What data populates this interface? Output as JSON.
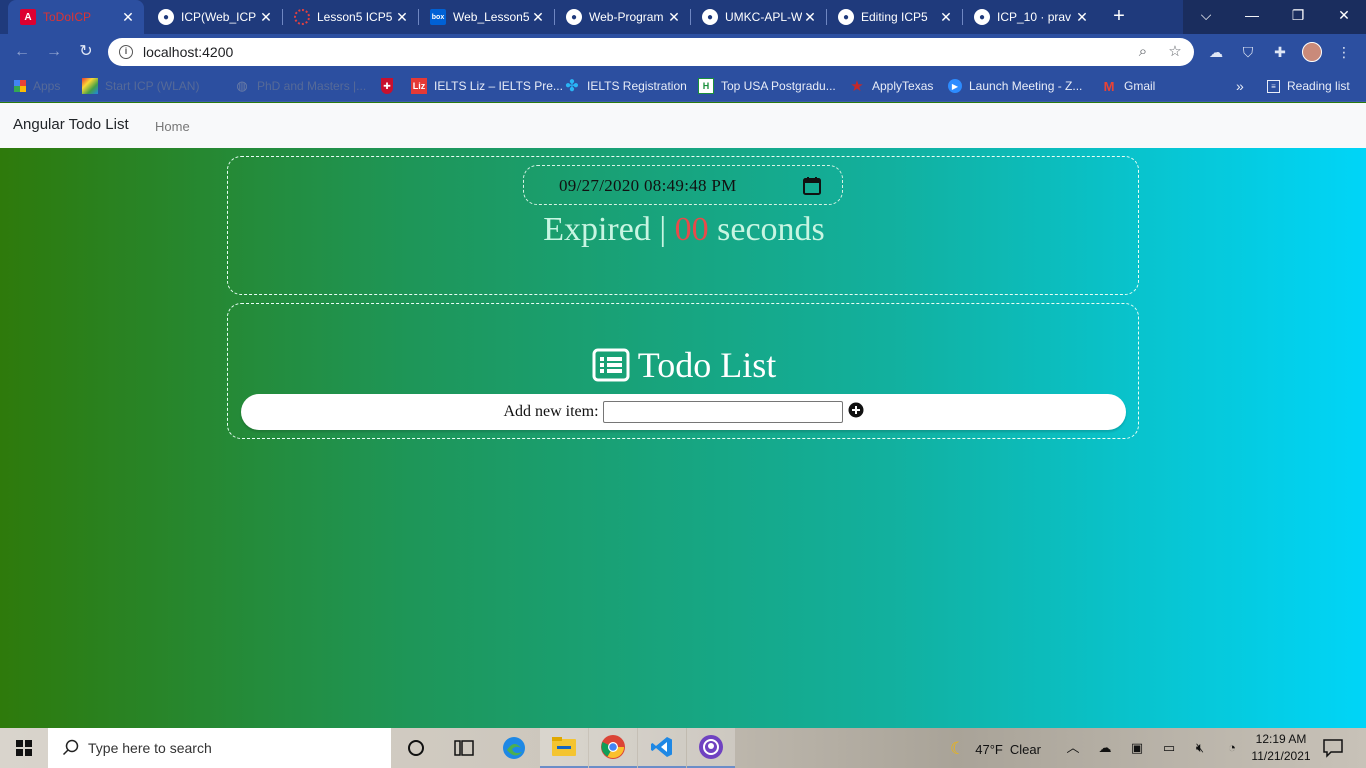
{
  "browser": {
    "tabs": [
      {
        "title": "ToDoICP",
        "favicon": "angular-icon",
        "active": true
      },
      {
        "title": "ICP(Web_ICP",
        "favicon": "github-icon"
      },
      {
        "title": "Lesson5 ICP5",
        "favicon": "loading-icon"
      },
      {
        "title": "Web_Lesson5",
        "favicon": "box-icon"
      },
      {
        "title": "Web-Program",
        "favicon": "github-icon"
      },
      {
        "title": "UMKC-APL-W",
        "favicon": "github-icon"
      },
      {
        "title": "Editing ICP5",
        "favicon": "github-icon"
      },
      {
        "title": "ICP_10 · prav",
        "favicon": "github-icon"
      }
    ],
    "new_tab": "+",
    "address": {
      "url": "localhost:4200"
    },
    "bookmarks": [
      {
        "label": "Apps",
        "icon": "apps-grid-icon",
        "faded": true
      },
      {
        "label": "Start ICP (WLAN)",
        "icon": "color-grid-icon",
        "faded": true
      },
      {
        "label": "PhD and Masters |...",
        "icon": "globe-icon",
        "faded": true
      },
      {
        "label": "",
        "icon": "shield-icon"
      },
      {
        "label": "IELTS Liz – IELTS Pre...",
        "icon": "liz-icon"
      },
      {
        "label": "IELTS Registration",
        "icon": "ielts-icon"
      },
      {
        "label": "Top USA Postgradu...",
        "icon": "h-icon"
      },
      {
        "label": "ApplyTexas",
        "icon": "star-icon"
      },
      {
        "label": "Launch Meeting - Z...",
        "icon": "zoom-icon"
      },
      {
        "label": "Gmail",
        "icon": "gmail-icon"
      }
    ],
    "bookmarks_overflow": "»",
    "reading_list": "Reading list"
  },
  "app": {
    "brand": "Angular Todo List",
    "nav_home": "Home",
    "datetime_value": "09/27/2020 08:49:48 PM",
    "status_prefix": "Expired | ",
    "status_count": "00",
    "status_suffix": " seconds",
    "todo_title": "Todo List",
    "add_label": "Add new item:",
    "add_input_value": ""
  },
  "taskbar": {
    "search_placeholder": "Type here to search",
    "weather_temp": "47°F",
    "weather_text": "Clear",
    "time": "12:19 AM",
    "date": "11/21/2021"
  },
  "colors": {
    "gradient_left": "#2e7a0b",
    "gradient_right": "#00d5f8",
    "status_count": "#e84a4a",
    "browser_frame": "#2c4fa0"
  }
}
